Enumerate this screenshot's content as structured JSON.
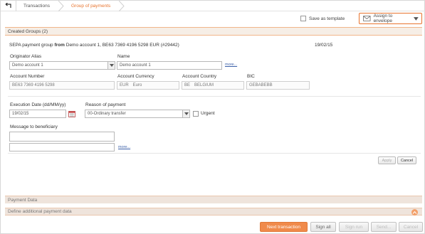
{
  "breadcrumb": {
    "back_icon": "back-arrow-icon",
    "items": [
      {
        "label": "Transactions"
      },
      {
        "label": "Group of payments"
      }
    ]
  },
  "actions": {
    "save_template_label": "Save as template",
    "assign_label": "Assign to envelope",
    "assign_icon": "envelope-icon"
  },
  "section": {
    "title": "Created Groups (2)"
  },
  "group": {
    "prefix": "SEPA payment group",
    "from_word": "from",
    "description": "Demo account 1, BE63 7369 4196 5298 EUR (#29442)",
    "date": "19/02/15"
  },
  "form": {
    "originator_alias_label": "Originator Alias",
    "originator_alias_value": "Demo account 1",
    "name_label": "Name",
    "name_value": "Demo account 1",
    "more_label": "more...",
    "account_number_label": "Account Number",
    "account_number_value": "BE63 7369 4196 5298",
    "account_currency_label": "Account Currency",
    "account_currency_code": "EUR",
    "account_currency_name": "Euro",
    "account_country_label": "Account Country",
    "account_country_code": "BE",
    "account_country_name": "BELGIUM",
    "bic_label": "BIC",
    "bic_value": "GEBABEBB",
    "execution_date_label": "Execution Date (dd/MM/yy)",
    "execution_date_value": "19/02/15",
    "reason_label": "Reason of payment",
    "reason_value": "00-Ordinary transfer",
    "urgent_label": "Urgent",
    "message_label": "Message to beneficiary",
    "message_line1": "",
    "message_line2": "",
    "message_more": "more..."
  },
  "form_buttons": {
    "apply": "Apply",
    "cancel": "Cancel"
  },
  "panels": {
    "payment_data": "Payment Data",
    "additional": "Define additional payment data"
  },
  "footer": {
    "next": "Next transaction",
    "sign_all": "Sign all",
    "sign_run": "Sign run",
    "send": "Send...",
    "cancel": "Cancel"
  },
  "colors": {
    "accent": "#e8742e",
    "primary_button": "#f08a4b",
    "section_bg": "#f6eee6"
  }
}
